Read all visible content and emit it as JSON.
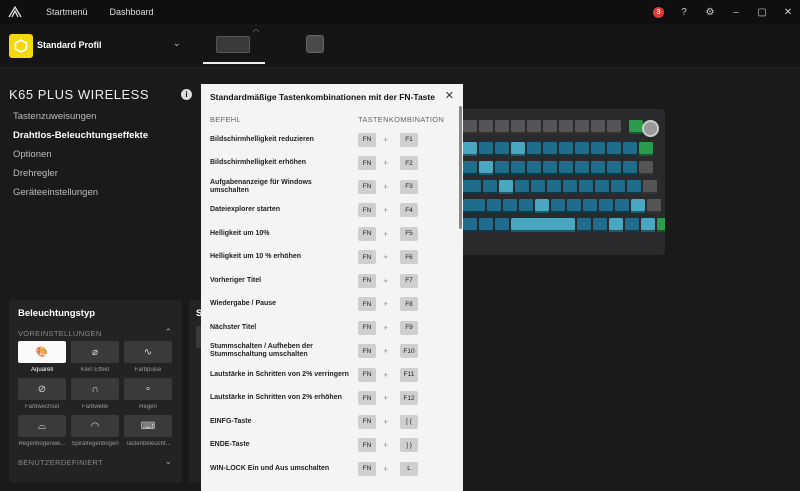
{
  "nav": {
    "home": "Startmenü",
    "dashboard": "Dashboard",
    "notification_count": "3"
  },
  "profile": {
    "name": "Standard Profil"
  },
  "device": {
    "title": "K65 PLUS WIRELESS"
  },
  "menu": [
    {
      "label": "Tastenzuweisungen",
      "active": false
    },
    {
      "label": "Drahtlos-Beleuchtungseffekte",
      "active": true
    },
    {
      "label": "Optionen",
      "active": false
    },
    {
      "label": "Drehregler",
      "active": false
    },
    {
      "label": "Geräteeinstellungen",
      "active": false
    }
  ],
  "lighting": {
    "title": "Beleuchtungstyp",
    "presets_label": "VOREINSTELLUNGEN",
    "custom_label": "BENUTZERDEFINIERT",
    "side_label": "S",
    "effects": [
      {
        "label": "Aquarell",
        "icon": "palette-icon",
        "selected": true
      },
      {
        "label": "Kein Effekt",
        "icon": "no-effect-icon",
        "selected": false
      },
      {
        "label": "Farbpulse",
        "icon": "pulse-icon",
        "selected": false
      },
      {
        "label": "Farbwechsel",
        "icon": "shift-icon",
        "selected": false
      },
      {
        "label": "Farbwelle",
        "icon": "wave-icon",
        "selected": false
      },
      {
        "label": "Regen",
        "icon": "rain-icon",
        "selected": false
      },
      {
        "label": "Regenbogenwe...",
        "icon": "rainbow-icon",
        "selected": false
      },
      {
        "label": "Spiralregenbogen",
        "icon": "spiral-icon",
        "selected": false
      },
      {
        "label": "Tastenbeleucht...",
        "icon": "keyboard-icon",
        "selected": false
      }
    ]
  },
  "modal": {
    "title": "Standardmäßige Tastenkombinationen mit der FN-Taste",
    "col_command": "BEFEHL",
    "col_combo": "TASTENKOMBINATION",
    "shortcuts": [
      {
        "command": "Bildschirmhelligkeit reduzieren",
        "key1": "FN",
        "key2": "F1"
      },
      {
        "command": "Bildschirmhelligkeit erhöhen",
        "key1": "FN",
        "key2": "F2"
      },
      {
        "command": "Aufgabenanzeige für Windows umschalten",
        "key1": "FN",
        "key2": "F3"
      },
      {
        "command": "Dateiexplorer starten",
        "key1": "FN",
        "key2": "F4"
      },
      {
        "command": "Helligkeit um 10%",
        "key1": "FN",
        "key2": "F5"
      },
      {
        "command": "Helligkeit um 10 % erhöhen",
        "key1": "FN",
        "key2": "F6"
      },
      {
        "command": "Vorheriger Titel",
        "key1": "FN",
        "key2": "F7"
      },
      {
        "command": "Wiedergabe / Pause",
        "key1": "FN",
        "key2": "F8"
      },
      {
        "command": "Nächster Titel",
        "key1": "FN",
        "key2": "F9"
      },
      {
        "command": "Stummschalten / Aufheben der Stummschaltung umschalten",
        "key1": "FN",
        "key2": "F10"
      },
      {
        "command": "Lautstärke in Schritten von 2% verringern",
        "key1": "FN",
        "key2": "F11"
      },
      {
        "command": "Lautstärke in Schritten von 2% erhöhen",
        "key1": "FN",
        "key2": "F12"
      },
      {
        "command": "EINFG-Taste",
        "key1": "FN",
        "key2": "[ {"
      },
      {
        "command": "ENDE-Taste",
        "key1": "FN",
        "key2": "] }"
      },
      {
        "command": "WIN-LOCK Ein und Aus umschalten",
        "key1": "FN",
        "key2": "L"
      }
    ]
  }
}
